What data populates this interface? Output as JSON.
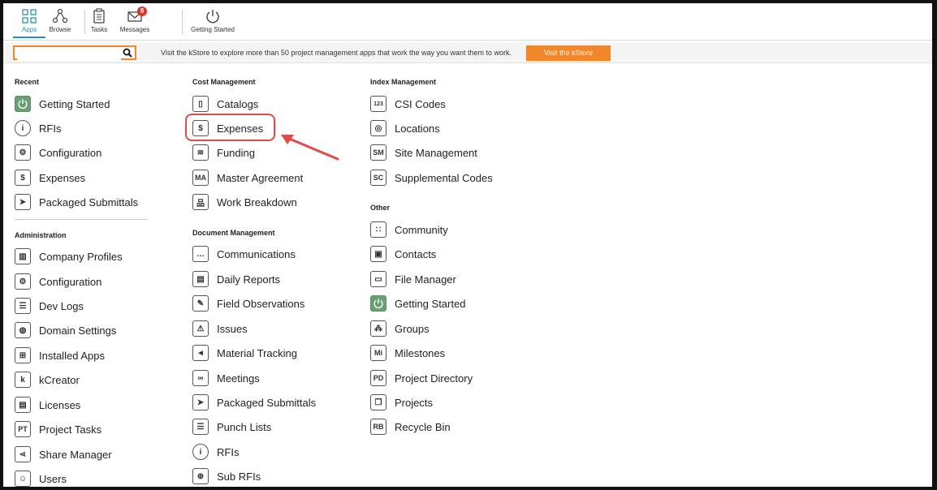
{
  "toolbar": {
    "items": [
      {
        "label": "Apps",
        "icon": "apps-icon",
        "active": true
      },
      {
        "label": "Browse",
        "icon": "browse-icon"
      },
      {
        "label": "Tasks",
        "icon": "tasks-icon"
      },
      {
        "label": "Messages",
        "icon": "messages-icon",
        "badge": "8"
      },
      {
        "label": "Getting Started",
        "icon": "power-icon"
      }
    ]
  },
  "search": {
    "value": "",
    "promo_text": "Visit the kStore to explore more than 50 project management apps that work the way you want them to work.",
    "button_label": "Visit the kStore"
  },
  "recent": {
    "heading": "Recent",
    "items": [
      {
        "label": "Getting Started",
        "icon": "power-icon"
      },
      {
        "label": "RFIs",
        "icon": "rfi-icon"
      },
      {
        "label": "Configuration",
        "icon": "gear-icon"
      },
      {
        "label": "Expenses",
        "icon": "dollar-icon"
      },
      {
        "label": "Packaged Submittals",
        "icon": "submittal-icon"
      }
    ]
  },
  "administration": {
    "heading": "Administration",
    "items": [
      {
        "label": "Company Profiles",
        "icon": "company-icon"
      },
      {
        "label": "Configuration",
        "icon": "gear-icon"
      },
      {
        "label": "Dev Logs",
        "icon": "devlog-icon"
      },
      {
        "label": "Domain Settings",
        "icon": "globe-icon"
      },
      {
        "label": "Installed Apps",
        "icon": "apps-icon"
      },
      {
        "label": "kCreator",
        "icon": "kcreator-icon"
      },
      {
        "label": "Licenses",
        "icon": "license-icon"
      },
      {
        "label": "Project Tasks",
        "icon": "pt-icon",
        "abbr": "PT"
      },
      {
        "label": "Share Manager",
        "icon": "share-icon"
      },
      {
        "label": "Users",
        "icon": "user-icon"
      }
    ]
  },
  "cost_management": {
    "heading": "Cost Management",
    "items": [
      {
        "label": "Catalogs",
        "icon": "book-icon"
      },
      {
        "label": "Expenses",
        "icon": "dollar-icon"
      },
      {
        "label": "Funding",
        "icon": "funding-icon"
      },
      {
        "label": "Master Agreement",
        "icon": "ma-icon",
        "abbr": "MA"
      },
      {
        "label": "Work Breakdown",
        "icon": "hierarchy-icon"
      }
    ]
  },
  "document_management": {
    "heading": "Document Management",
    "items": [
      {
        "label": "Communications",
        "icon": "chat-icon"
      },
      {
        "label": "Daily Reports",
        "icon": "report-icon"
      },
      {
        "label": "Field Observations",
        "icon": "observation-icon"
      },
      {
        "label": "Issues",
        "icon": "warning-icon"
      },
      {
        "label": "Material Tracking",
        "icon": "send-icon"
      },
      {
        "label": "Meetings",
        "icon": "meeting-icon"
      },
      {
        "label": "Packaged Submittals",
        "icon": "submittal-icon"
      },
      {
        "label": "Punch Lists",
        "icon": "list-icon"
      },
      {
        "label": "RFIs",
        "icon": "rfi-icon"
      },
      {
        "label": "Sub RFIs",
        "icon": "sub-rfi-icon"
      }
    ]
  },
  "index_management": {
    "heading": "Index Management",
    "items": [
      {
        "label": "CSI Codes",
        "icon": "csi-icon"
      },
      {
        "label": "Locations",
        "icon": "location-icon"
      },
      {
        "label": "Site Management",
        "icon": "sm-icon",
        "abbr": "SM"
      },
      {
        "label": "Supplemental Codes",
        "icon": "sc-icon",
        "abbr": "SC"
      }
    ]
  },
  "other": {
    "heading": "Other",
    "items": [
      {
        "label": "Community",
        "icon": "community-icon"
      },
      {
        "label": "Contacts",
        "icon": "contacts-icon"
      },
      {
        "label": "File Manager",
        "icon": "folder-icon"
      },
      {
        "label": "Getting Started",
        "icon": "power-icon"
      },
      {
        "label": "Groups",
        "icon": "groups-icon"
      },
      {
        "label": "Milestones",
        "icon": "mi-icon",
        "abbr": "Mi"
      },
      {
        "label": "Project Directory",
        "icon": "pd-icon",
        "abbr": "PD"
      },
      {
        "label": "Projects",
        "icon": "projects-icon"
      },
      {
        "label": "Recycle Bin",
        "icon": "rb-icon",
        "abbr": "RB"
      }
    ]
  },
  "colors": {
    "accent": "#f0872a",
    "active_tab": "#2a8fbd",
    "highlight": "#e24a4a",
    "badge": "#d9352b"
  }
}
